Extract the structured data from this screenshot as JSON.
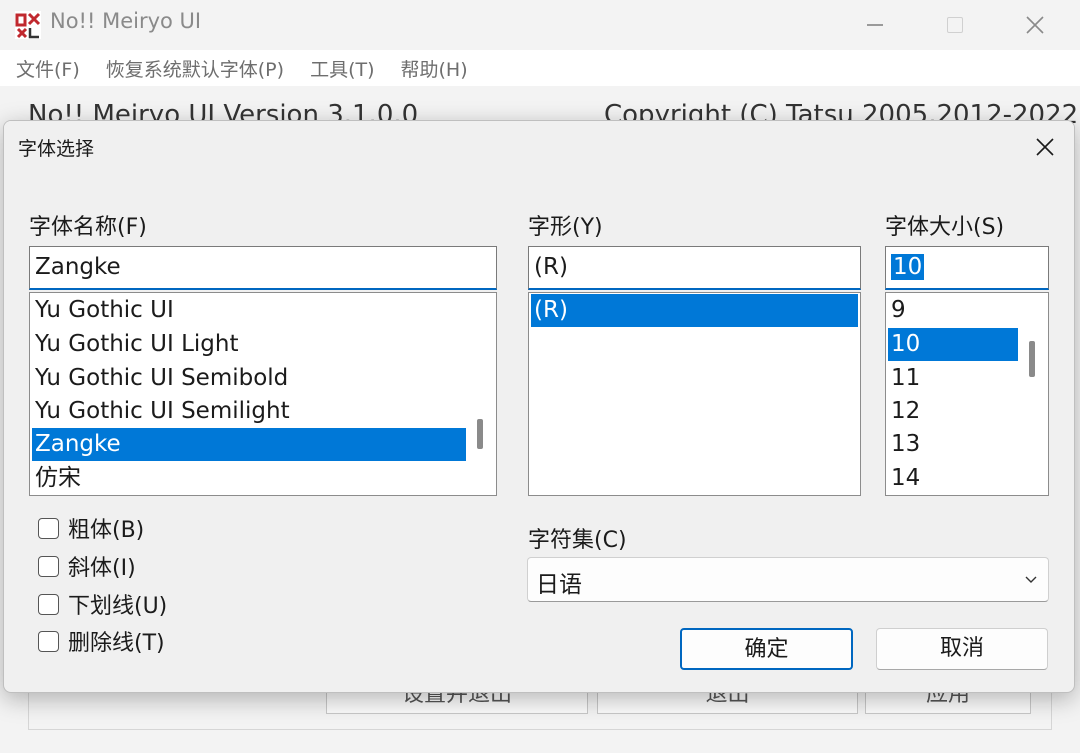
{
  "app": {
    "title": "No!! Meiryo UI",
    "version_text": "No!! Meiryo UI Version 3.1.0.0",
    "copyright_text": "Copyright (C) Tatsu 2005,2012-2022"
  },
  "menu": {
    "items": [
      {
        "label": "文件(F)"
      },
      {
        "label": "恢复系统默认字体(P)"
      },
      {
        "label": "工具(T)"
      },
      {
        "label": "帮助(H)"
      }
    ]
  },
  "background_buttons": {
    "set_exit": "设置并退出",
    "exit": "退出",
    "apply": "应用"
  },
  "dialog": {
    "title": "字体选择",
    "font_name": {
      "label": "字体名称(F)",
      "value": "Zangke",
      "items": [
        {
          "label": "Yu Gothic UI",
          "selected": false
        },
        {
          "label": "Yu Gothic UI Light",
          "selected": false
        },
        {
          "label": "Yu Gothic UI Semibold",
          "selected": false
        },
        {
          "label": "Yu Gothic UI Semilight",
          "selected": false
        },
        {
          "label": "Zangke",
          "selected": true
        },
        {
          "label": "仿宋",
          "selected": false
        }
      ]
    },
    "font_style": {
      "label": "字形(Y)",
      "value": "(R)",
      "items": [
        {
          "label": "(R)",
          "selected": true
        }
      ]
    },
    "font_size": {
      "label": "字体大小(S)",
      "value": "10",
      "items": [
        {
          "label": "9",
          "selected": false
        },
        {
          "label": "10",
          "selected": true
        },
        {
          "label": "11",
          "selected": false
        },
        {
          "label": "12",
          "selected": false
        },
        {
          "label": "13",
          "selected": false
        },
        {
          "label": "14",
          "selected": false
        }
      ]
    },
    "effects": [
      {
        "label": "粗体(B)",
        "checked": false
      },
      {
        "label": "斜体(I)",
        "checked": false
      },
      {
        "label": "下划线(U)",
        "checked": false
      },
      {
        "label": "删除线(T)",
        "checked": false
      }
    ],
    "charset": {
      "label": "字符集(C)",
      "value": "日语"
    },
    "ok_label": "确定",
    "cancel_label": "取消"
  },
  "colors": {
    "selection": "#0078d7",
    "focus_border": "#0067c0",
    "app_icon_red": "#c0282e"
  },
  "icons": {
    "app": "app-logo-icon",
    "close": "close-icon",
    "dropdown": "chevron-down-icon"
  }
}
